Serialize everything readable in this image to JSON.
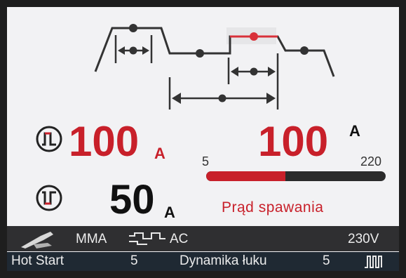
{
  "waveform": {
    "name": "welding-waveform-diagram"
  },
  "hot_current": {
    "value": "100",
    "unit": "A"
  },
  "base_current": {
    "value": "50",
    "unit": "A"
  },
  "setting": {
    "value": "100",
    "unit": "A",
    "min": "5",
    "max": "220",
    "current": 100,
    "caption": "Prąd spawania"
  },
  "status_bar": {
    "process": "MMA",
    "polarity": "AC",
    "voltage": "230V"
  },
  "params_bar": {
    "hot_start_label": "Hot Start",
    "hot_start_value": "5",
    "arc_force_label": "Dynamika łuku",
    "arc_force_value": "5"
  },
  "colors": {
    "accent": "#c8202a",
    "bar_track": "#2b2b2b",
    "screen_bg": "#f2f2f4",
    "status_bg": "#2f2f31"
  }
}
